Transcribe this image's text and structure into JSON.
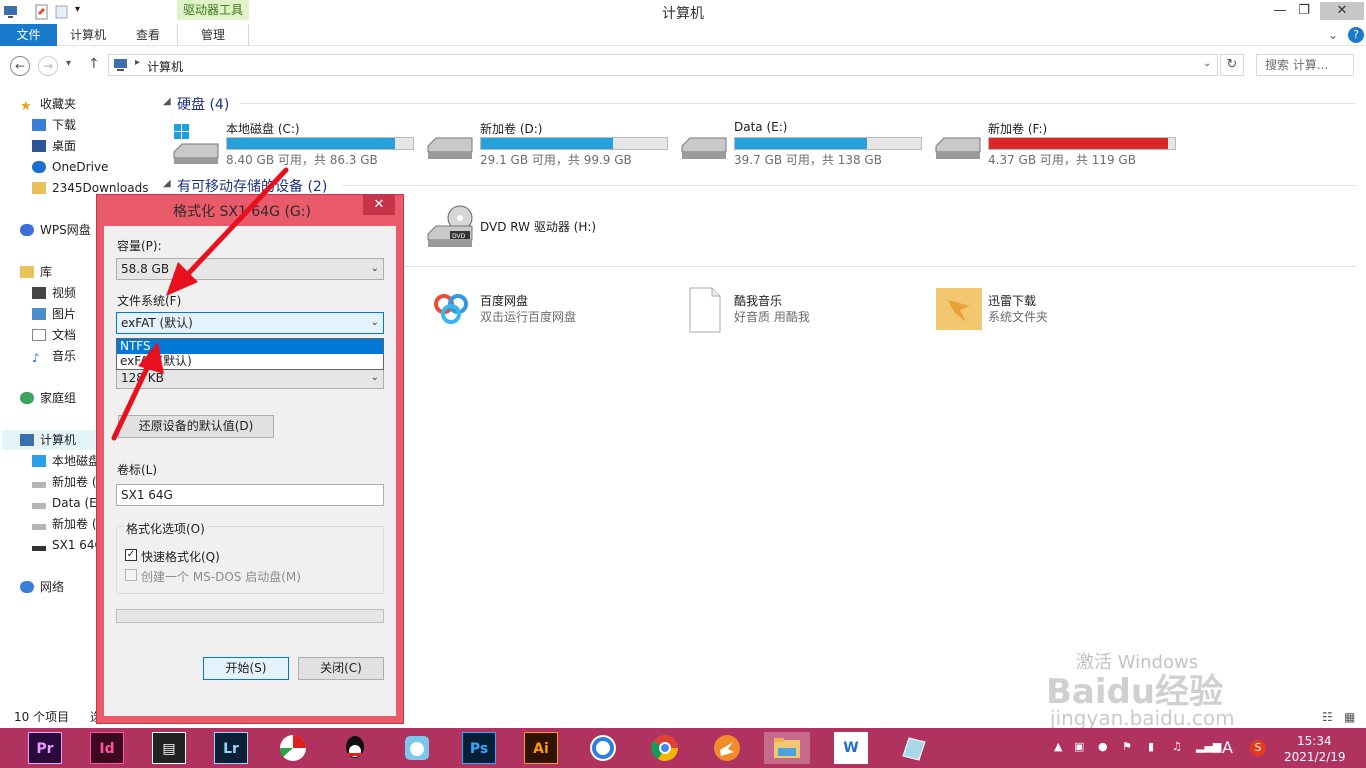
{
  "window": {
    "title": "计算机",
    "context_tab": "驱动器工具",
    "minimize": "—",
    "maximize": "❐",
    "close": "✕"
  },
  "ribbon": {
    "file": "文件",
    "computer": "计算机",
    "view": "查看",
    "manage": "管理",
    "expand": "⌄",
    "help": "?"
  },
  "address": {
    "path": "计算机",
    "search_placeholder": "搜索 计算...",
    "back": "←",
    "forward": "→",
    "recent": "▾",
    "up": "↑"
  },
  "nav": {
    "favorites": "收藏夹",
    "downloads": "下载",
    "desktop": "桌面",
    "onedrive": "OneDrive",
    "d2345": "2345Downloads",
    "wps": "WPS网盘",
    "library": "库",
    "videos": "视频",
    "pictures": "图片",
    "documents": "文档",
    "music": "音乐",
    "homegroup": "家庭组",
    "computer": "计算机",
    "c": "本地磁盘",
    "d": "新加卷 (",
    "e": "Data (E:",
    "f": "新加卷 (",
    "sx1": "SX1 64G",
    "network": "网络"
  },
  "content": {
    "hdd_header": "硬盘 (4)",
    "removable_header": "有可移动存储的设备 (2)",
    "drives": [
      {
        "name": "本地磁盘 (C:)",
        "free": "8.40 GB 可用，共 86.3 GB",
        "used_fraction": 0.903
      },
      {
        "name": "新加卷 (D:)",
        "free": "29.1 GB 可用，共 99.9 GB",
        "used_fraction": 0.709
      },
      {
        "name": "Data (E:)",
        "free": "39.7 GB 可用，共 138 GB",
        "used_fraction": 0.712
      },
      {
        "name": "新加卷 (F:)",
        "free": "4.37 GB 可用，共 119 GB",
        "used_fraction": 0.963
      }
    ],
    "dvd": "DVD RW 驱动器 (H:)",
    "baidu_name": "百度网盘",
    "baidu_desc": "双击运行百度网盘",
    "kuwo_name": "酷我音乐",
    "kuwo_desc": "好音质 用酷我",
    "xunlei_name": "迅雷下载",
    "xunlei_desc": "系统文件夹"
  },
  "status": {
    "count": "10 个项目",
    "selected": "选"
  },
  "dialog": {
    "title": "格式化 SX1 64G (G:)",
    "close": "✕",
    "capacity_label": "容量(P):",
    "capacity_value": "58.8 GB",
    "fs_label": "文件系统(F)",
    "fs_value": "exFAT (默认)",
    "fs_options": [
      "NTFS",
      "exFAT (默认)"
    ],
    "alloc_value": "128 KB",
    "restore_button": "还原设备的默认值(D)",
    "volume_label": "卷标(L)",
    "volume_value": "SX1 64G",
    "options_label": "格式化选项(O)",
    "quick_format": "快速格式化(Q)",
    "msdos": "创建一个 MS-DOS 启动盘(M)",
    "start_button": "开始(S)",
    "close_button": "关闭(C)"
  },
  "watermark": {
    "activate": "激活 Windows",
    "baidu": "Baidu经验",
    "site": "jingyan.baidu.com"
  },
  "taskbar": {
    "apps": [
      "Pr",
      "Id",
      "",
      "Lr",
      "",
      "",
      "",
      "Ps",
      "Ai",
      "",
      "",
      "",
      "",
      "W",
      ""
    ],
    "ime": "A",
    "time": "15:34",
    "date": "2021/2/19"
  },
  "colors": {
    "accent": "#1979ca",
    "drive_bar": "#26a0da",
    "drive_bar_full": "#da2626",
    "dialog_frame": "#e95a6b",
    "taskbar": "#b0325f",
    "annotation_arrow": "#e8101e"
  }
}
